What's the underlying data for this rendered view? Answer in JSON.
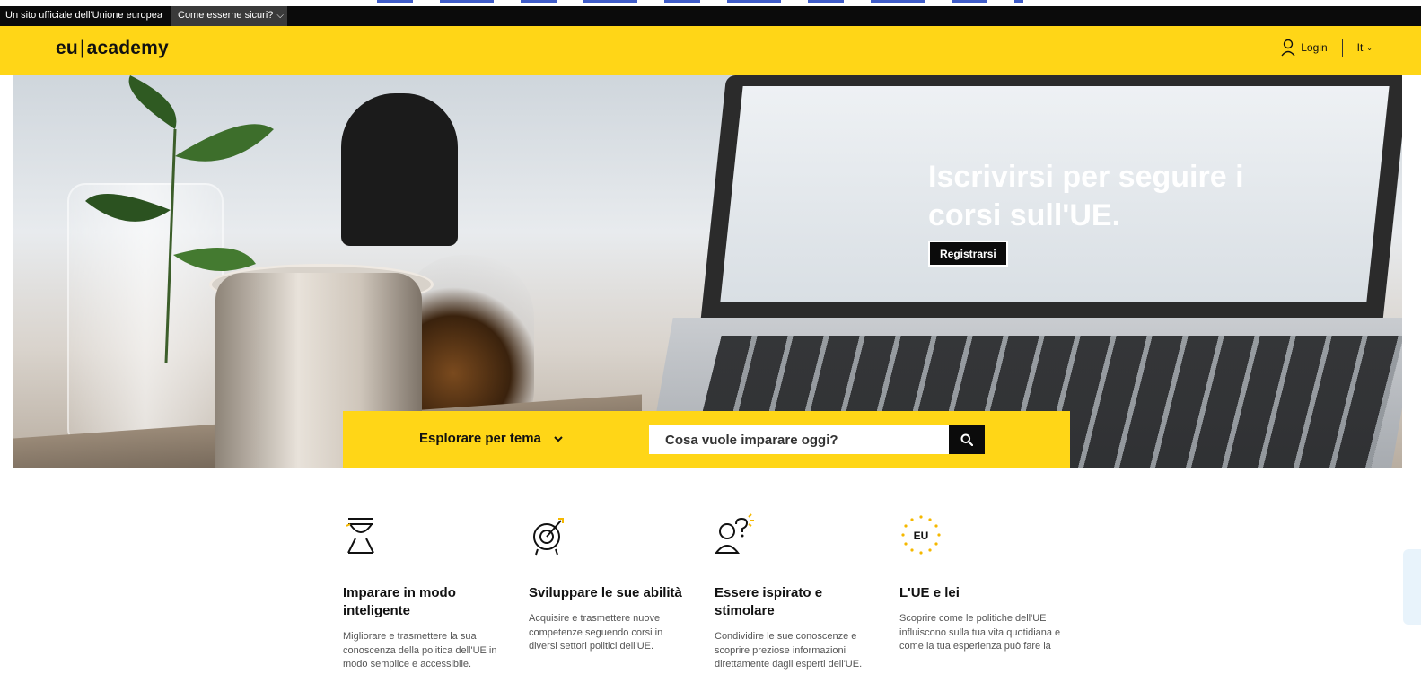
{
  "official_bar": {
    "text": "Un sito ufficiale dell'Unione europea",
    "link": "Come esserne sicuri?"
  },
  "header": {
    "logo_left": "eu",
    "logo_right": "academy",
    "login_label": "Login",
    "language": "It"
  },
  "hero": {
    "title": "Iscrivirsi per seguire i corsi sull'UE.",
    "register_label": "Registrarsi"
  },
  "search": {
    "explore_label": "Esplorare per tema",
    "placeholder": "Cosa vuole imparare oggi?"
  },
  "features": [
    {
      "title": "Imparare in modo inteligente",
      "description": "Migliorare e trasmettere la sua conoscenza della politica dell'UE in modo semplice e accessibile."
    },
    {
      "title": "Sviluppare le sue abilità",
      "description": "Acquisire e trasmettere nuove competenze seguendo corsi in diversi settori politici dell'UE."
    },
    {
      "title": "Essere ispirato e stimolare",
      "description": "Condividire le sue conoscenze e scoprire preziose informazioni direttamente dagli esperti dell'UE."
    },
    {
      "title": "L'UE e lei",
      "description": "Scoprire come le politiche dell'UE influiscono sulla tua vita quotidiana e come la tua esperienza può fare la"
    }
  ],
  "eu_badge": "EU",
  "colors": {
    "brand_yellow": "#ffd617",
    "dark": "#0b0b0b"
  }
}
